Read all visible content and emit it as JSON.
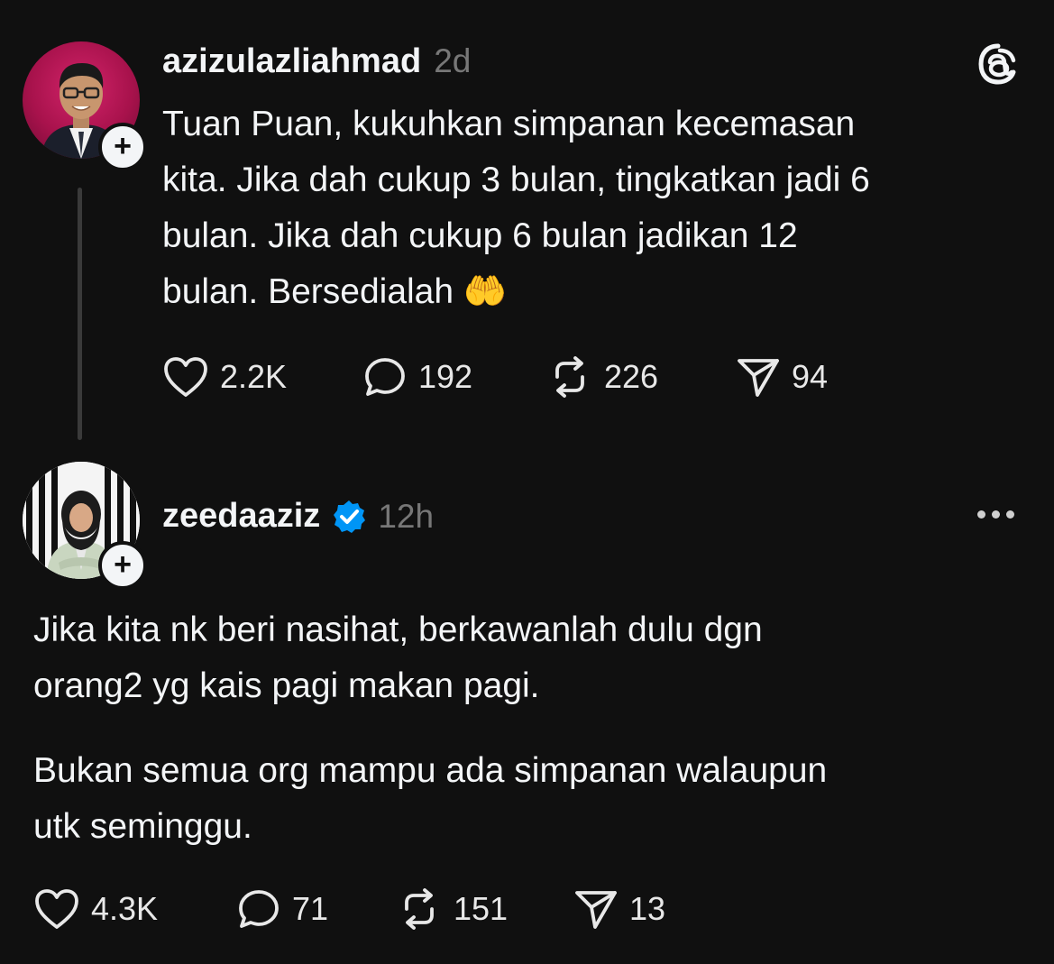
{
  "posts": [
    {
      "username": "azizulazliahmad",
      "time": "2d",
      "text_lines": [
        "Tuan Puan, kukuhkan simpanan kecemasan",
        "kita. Jika dah cukup 3 bulan, tingkatkan jadi 6",
        "bulan. Jika dah cukup 6 bulan jadikan 12",
        "bulan. Bersedialah 🤲"
      ],
      "stats": {
        "likes": "2.2K",
        "replies": "192",
        "reposts": "226",
        "shares": "94"
      }
    },
    {
      "username": "zeedaaziz",
      "time": "12h",
      "verified": true,
      "paragraphs": [
        [
          "Jika kita nk beri nasihat, berkawanlah dulu dgn",
          "orang2 yg kais pagi makan pagi."
        ],
        [
          "Bukan semua org mampu ada simpanan walaupun",
          "utk seminggu."
        ]
      ],
      "stats": {
        "likes": "4.3K",
        "replies": "71",
        "reposts": "151",
        "shares": "13"
      }
    }
  ],
  "icons": {
    "follow": "+",
    "app_logo": "threads-logo-icon",
    "more": "more-icon",
    "like": "heart-icon",
    "reply": "comment-icon",
    "repost": "repost-icon",
    "share": "send-icon"
  },
  "colors": {
    "background": "#101010",
    "text": "#f3f5f7",
    "muted": "#777777",
    "verified": "#0095f6"
  }
}
